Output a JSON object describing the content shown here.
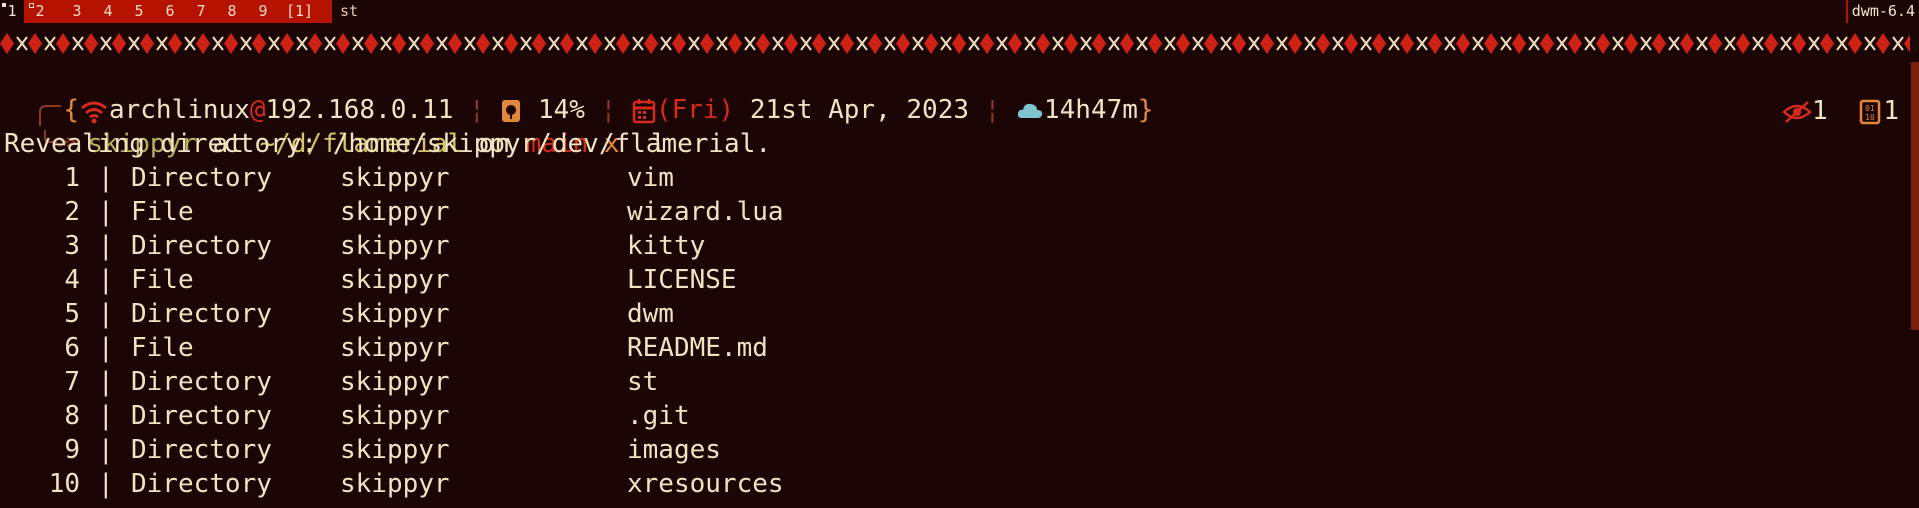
{
  "bar": {
    "tags": [
      "1",
      "2",
      "3",
      "4",
      "5",
      "6",
      "7",
      "8",
      "9"
    ],
    "layout": "[1]",
    "window_title": "st",
    "status": "dwm-6.4"
  },
  "prompt": {
    "user_host": "archlinux",
    "at_sign": "@",
    "ip": "192.168.0.11",
    "battery": "14%",
    "day": "(Fri)",
    "date": "21st Apr, 2023",
    "uptime": "14h47m",
    "open_brace": "{",
    "close_brace": "}",
    "separator": "¦",
    "user": "skippyr",
    "at_word": "at",
    "path": "~/d/flamerial",
    "on_word": "on",
    "branch": "main",
    "dirty_mark": "x",
    "command": "l",
    "hidden_count": "1",
    "file_count": "1"
  },
  "output": {
    "header": "Revealing directory: /home/skippyr/dev/flamerial.",
    "rows": [
      {
        "idx": "1",
        "type": "Directory",
        "owner": "skippyr",
        "name": "vim"
      },
      {
        "idx": "2",
        "type": "File",
        "owner": "skippyr",
        "name": "wizard.lua"
      },
      {
        "idx": "3",
        "type": "Directory",
        "owner": "skippyr",
        "name": "kitty"
      },
      {
        "idx": "4",
        "type": "File",
        "owner": "skippyr",
        "name": "LICENSE"
      },
      {
        "idx": "5",
        "type": "Directory",
        "owner": "skippyr",
        "name": "dwm"
      },
      {
        "idx": "6",
        "type": "File",
        "owner": "skippyr",
        "name": "README.md"
      },
      {
        "idx": "7",
        "type": "Directory",
        "owner": "skippyr",
        "name": "st"
      },
      {
        "idx": "8",
        "type": "Directory",
        "owner": "skippyr",
        "name": ".git"
      },
      {
        "idx": "9",
        "type": "Directory",
        "owner": "skippyr",
        "name": "images"
      },
      {
        "idx": "10",
        "type": "Directory",
        "owner": "skippyr",
        "name": "xresources"
      }
    ],
    "column_separator": "|"
  },
  "colors": {
    "background": "#1c0505",
    "bar": "#b51200",
    "accent_red": "#d62a1a",
    "accent_orange": "#e2883a",
    "text": "#efe3c2"
  }
}
